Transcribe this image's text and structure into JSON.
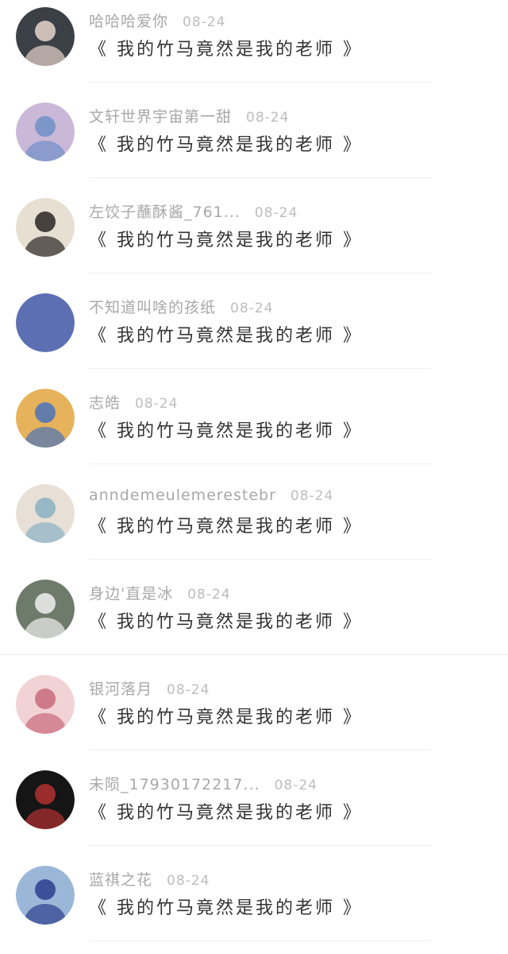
{
  "comments": [
    {
      "username": "哈哈哈爱你",
      "date": "08-24",
      "content": "《 我的竹马竟然是我的老师 》",
      "avatar": {
        "bg": "#3b3f46",
        "fg": "#e8d6cc",
        "name": "boy-portrait-avatar-icon"
      }
    },
    {
      "username": "文轩世界宇宙第一甜",
      "date": "08-24",
      "content": "《 我的竹马竟然是我的老师 》",
      "avatar": {
        "bg": "#c9b8d8",
        "fg": "#6f8fc7",
        "name": "duo-photo-avatar-icon"
      }
    },
    {
      "username": "左饺子蘸酥酱_761...",
      "date": "08-24",
      "content": "《 我的竹马竟然是我的老师 》",
      "avatar": {
        "bg": "#e7dfd2",
        "fg": "#2a2522",
        "name": "tufted-chair-avatar-icon"
      }
    },
    {
      "username": "不知道叫啥的孩纸",
      "date": "08-24",
      "content": "《 我的竹马竟然是我的老师 》",
      "avatar": {
        "bg": "#5d6fb3",
        "fg": "#5d6fb3",
        "name": "solid-blue-avatar-icon"
      }
    },
    {
      "username": "志皓",
      "date": "08-24",
      "content": "《 我的竹马竟然是我的老师 》",
      "avatar": {
        "bg": "#e6b25c",
        "fg": "#4a73b8",
        "name": "sunlit-group-avatar-icon"
      }
    },
    {
      "username": "anndemeulemerestebr",
      "date": "08-24",
      "content": "《 我的竹马竟然是我的老师 》",
      "avatar": {
        "bg": "#e8e0d6",
        "fg": "#8ab0c4",
        "name": "photo-frame-avatar-icon"
      }
    },
    {
      "username": "身边'直是冰",
      "date": "08-24",
      "content": "《 我的竹马竟然是我的老师 》",
      "avatar": {
        "bg": "#6f7b6a",
        "fg": "#f0f0f0",
        "name": "dark-hair-avatar-icon"
      }
    },
    {
      "username": "银河落月",
      "date": "08-24",
      "content": "《 我的竹马竟然是我的老师 》",
      "avatar": {
        "bg": "#f1d3d6",
        "fg": "#c96a7a",
        "name": "pink-flower-avatar-icon"
      }
    },
    {
      "username": "未陨_17930172217...",
      "date": "08-24",
      "content": "《 我的竹马竟然是我的老师 》",
      "avatar": {
        "bg": "#151515",
        "fg": "#b23030",
        "name": "masked-dark-avatar-icon"
      }
    },
    {
      "username": "蓝祺之花",
      "date": "08-24",
      "content": "《 我的竹马竟然是我的老师 》",
      "avatar": {
        "bg": "#9bb7d8",
        "fg": "#2c3e8f",
        "name": "blue-outfit-avatar-icon"
      }
    }
  ]
}
